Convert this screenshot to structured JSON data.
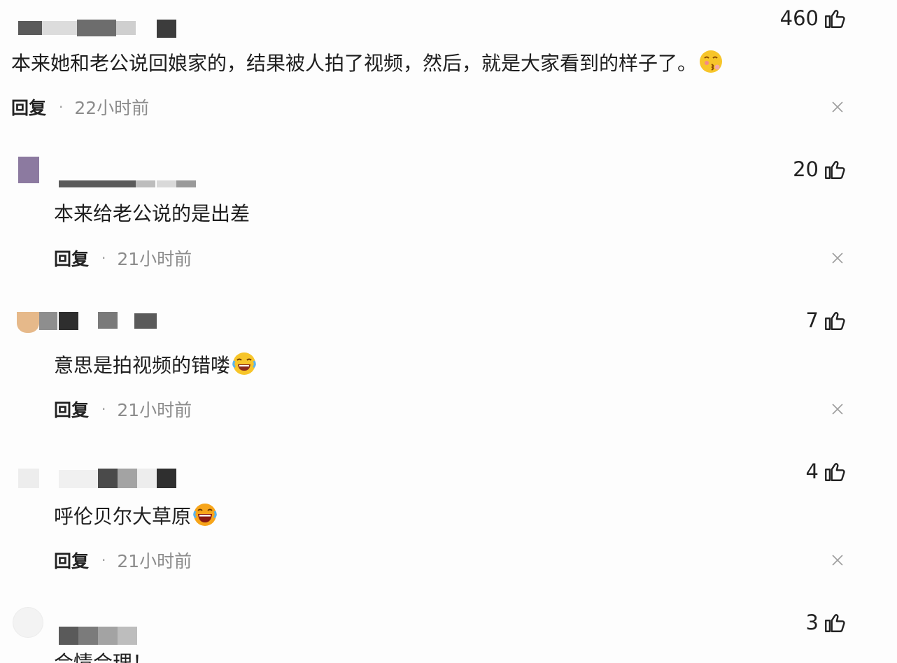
{
  "comments": [
    {
      "likes": "460",
      "text": "本来她和老公说回娘家的，结果被人拍了视频，然后，就是大家看到的样子了。",
      "emoji": "kiss-face-emoji",
      "reply_label": "回复",
      "time": "22小时前"
    },
    {
      "likes": "20",
      "text": "本来给老公说的是出差",
      "reply_label": "回复",
      "time": "21小时前"
    },
    {
      "likes": "7",
      "text": "意思是拍视频的错喽",
      "emoji": "laugh-cry-emoji",
      "reply_label": "回复",
      "time": "21小时前"
    },
    {
      "likes": "4",
      "text": "呼伦贝尔大草原",
      "emoji": "laugh-cry-emoji",
      "reply_label": "回复",
      "time": "21小时前"
    },
    {
      "likes": "3",
      "text": "合情合理！"
    }
  ],
  "icons": {
    "like": "thumbs-up-icon",
    "close": "close-icon"
  },
  "colors": {
    "background": "#fdfdfd",
    "time_text": "#8c8c8c",
    "emoji_yellow": "#f7c52a"
  }
}
